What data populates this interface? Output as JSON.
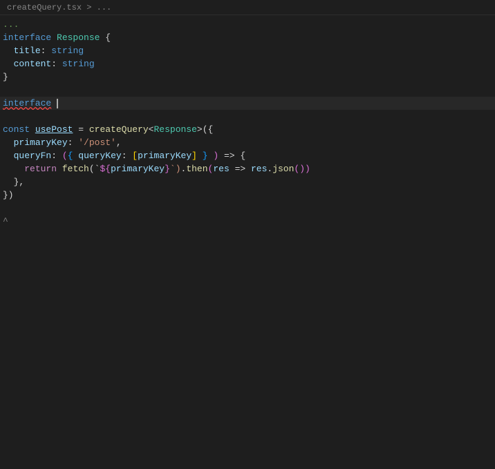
{
  "breadcrumb": {
    "text": "createQuery.tsx > ..."
  },
  "lines": [
    {
      "num": "",
      "tokens": [
        {
          "text": "...",
          "class": "comment"
        }
      ]
    },
    {
      "num": "",
      "tokens": [
        {
          "text": "interface",
          "class": "kw-interface"
        },
        {
          "text": " ",
          "class": ""
        },
        {
          "text": "Response",
          "class": "type-name"
        },
        {
          "text": " {",
          "class": "punct"
        }
      ]
    },
    {
      "num": "",
      "tokens": [
        {
          "text": "  ",
          "class": ""
        },
        {
          "text": "title",
          "class": "prop-name"
        },
        {
          "text": ": ",
          "class": "punct"
        },
        {
          "text": "string",
          "class": "kw-interface"
        }
      ]
    },
    {
      "num": "",
      "tokens": [
        {
          "text": "  ",
          "class": ""
        },
        {
          "text": "content",
          "class": "prop-name"
        },
        {
          "text": ": ",
          "class": "punct"
        },
        {
          "text": "string",
          "class": "kw-interface"
        }
      ]
    },
    {
      "num": "",
      "tokens": [
        {
          "text": "}",
          "class": "punct"
        }
      ]
    },
    {
      "num": "",
      "tokens": []
    },
    {
      "num": "",
      "tokens": [
        {
          "text": "interface",
          "class": "kw-interface squiggly-error"
        },
        {
          "text": " ",
          "class": ""
        },
        {
          "text": "|",
          "class": "cursor-marker"
        }
      ],
      "cursor": true
    },
    {
      "num": "",
      "tokens": []
    },
    {
      "num": "",
      "tokens": [
        {
          "text": "const",
          "class": "kw-const"
        },
        {
          "text": " ",
          "class": ""
        },
        {
          "text": "usePost",
          "class": "underlined-var"
        },
        {
          "text": " = ",
          "class": "punct"
        },
        {
          "text": "createQuery",
          "class": "func-name"
        },
        {
          "text": "<",
          "class": "punct"
        },
        {
          "text": "Response",
          "class": "type-name"
        },
        {
          "text": ">({",
          "class": "punct"
        }
      ]
    },
    {
      "num": "",
      "tokens": [
        {
          "text": "  ",
          "class": ""
        },
        {
          "text": "primaryKey",
          "class": "prop-name"
        },
        {
          "text": ": ",
          "class": "punct"
        },
        {
          "text": "'/post'",
          "class": "string-val"
        },
        {
          "text": ",",
          "class": "punct"
        }
      ]
    },
    {
      "num": "",
      "tokens": [
        {
          "text": "  ",
          "class": ""
        },
        {
          "text": "queryFn",
          "class": "prop-name"
        },
        {
          "text": ": ",
          "class": "punct"
        },
        {
          "text": "(",
          "class": "bracket2"
        },
        {
          "text": "{",
          "class": "bracket3"
        },
        {
          "text": " ",
          "class": ""
        },
        {
          "text": "queryKey",
          "class": "param-name"
        },
        {
          "text": ": ",
          "class": "punct"
        },
        {
          "text": "[",
          "class": "bracket"
        },
        {
          "text": "primaryKey",
          "class": "param-name"
        },
        {
          "text": "]",
          "class": "bracket"
        },
        {
          "text": " ",
          "class": ""
        },
        {
          "text": "}",
          "class": "bracket3"
        },
        {
          "text": " )",
          "class": "bracket2"
        },
        {
          "text": " => {",
          "class": "punct"
        }
      ]
    },
    {
      "num": "",
      "tokens": [
        {
          "text": "    ",
          "class": ""
        },
        {
          "text": "return",
          "class": "kw-return"
        },
        {
          "text": " ",
          "class": ""
        },
        {
          "text": "fetch",
          "class": "func-name"
        },
        {
          "text": "(`",
          "class": "punct"
        },
        {
          "text": "${",
          "class": "bracket2"
        },
        {
          "text": "primaryKey",
          "class": "param-name"
        },
        {
          "text": "}",
          "class": "bracket2"
        },
        {
          "text": "`)",
          "class": "string-val"
        },
        {
          "text": ".",
          "class": "punct"
        },
        {
          "text": "then",
          "class": "func-name"
        },
        {
          "text": "(",
          "class": "bracket2"
        },
        {
          "text": "res",
          "class": "param-name"
        },
        {
          "text": " => ",
          "class": "punct"
        },
        {
          "text": "res",
          "class": "param-name"
        },
        {
          "text": ".",
          "class": "punct"
        },
        {
          "text": "json",
          "class": "func-name"
        },
        {
          "text": "()",
          "class": "bracket2"
        },
        {
          "text": ")",
          "class": "bracket2"
        }
      ]
    },
    {
      "num": "",
      "tokens": [
        {
          "text": "  },",
          "class": "punct"
        }
      ]
    },
    {
      "num": "",
      "tokens": [
        {
          "text": "})",
          "class": "punct"
        }
      ]
    },
    {
      "num": "",
      "tokens": []
    },
    {
      "num": "",
      "tokens": [
        {
          "text": "^",
          "class": "tilde-line"
        }
      ]
    }
  ]
}
